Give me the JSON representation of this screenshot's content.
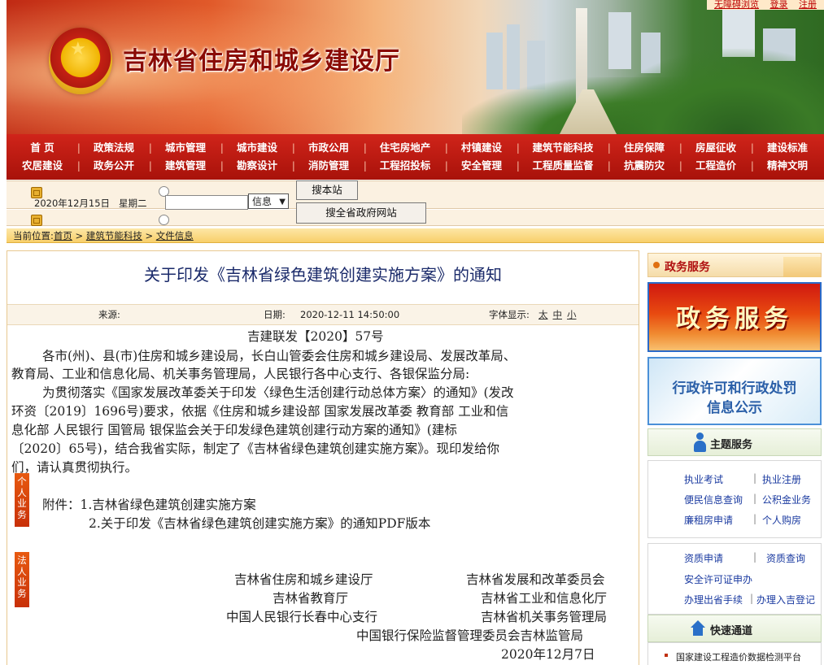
{
  "header": {
    "site_title": "吉林省住房和城乡建设厅",
    "top_links": [
      "无障碍浏览",
      "登录",
      "注册"
    ]
  },
  "nav": {
    "row1": [
      "首  页",
      "政策法规",
      "城市管理",
      "城市建设",
      "市政公用",
      "住宅房地产",
      "村镇建设",
      "建筑节能科技",
      "住房保障",
      "房屋征收",
      "建设标准"
    ],
    "row2": [
      "农居建设",
      "政务公开",
      "建筑管理",
      "勘察设计",
      "消防管理",
      "工程招投标",
      "安全管理",
      "工程质量监督",
      "抗震防灾",
      "工程造价",
      "精神文明"
    ]
  },
  "search": {
    "date": "2020年12月15日",
    "weekday": "星期二",
    "input_value": "",
    "select_value": "信息",
    "btn_site": "搜本站",
    "btn_gov": "搜全省政府网站"
  },
  "breadcrumb": {
    "prefix": "当前位置:",
    "items": [
      "首页",
      "建筑节能科技",
      "文件信息"
    ],
    "sep": ">"
  },
  "article": {
    "title": "关于印发《吉林省绿色建筑创建实施方案》的通知",
    "source_label": "来源:",
    "date_label": "日期:",
    "date_value": "2020-12-11 14:50:00",
    "font_label": "字体显示:",
    "font_sizes": [
      "太",
      "中",
      "小"
    ],
    "doc_no": "吉建联发【2020】57号",
    "lines": [
      "各市(州)、县(市)住房和城乡建设局，长白山管委会住房和城乡建设局、发展改革局、",
      "教育局、工业和信息化局、机关事务管理局，人民银行各中心支行、各银保监分局:",
      "为贯彻落实《国家发展改革委关于印发〈绿色生活创建行动总体方案〉的通知》(发改",
      "环资〔2019〕1696号)要求，依据《住房和城乡建设部 国家发展改革委 教育部 工业和信",
      "息化部 人民银行 国管局 银保监会关于印发绿色建筑创建行动方案的通知》(建标",
      "〔2020〕65号)，结合我省实际，制定了《吉林省绿色建筑创建实施方案》。现印发给你",
      "们，请认真贯彻执行。"
    ],
    "attach1": "附件：1.吉林省绿色建筑创建实施方案",
    "attach2": "2.关于印发《吉林省绿色建筑创建实施方案》的通知PDF版本",
    "sign_left": [
      "吉林省住房和城乡建设厅",
      "吉林省教育厅",
      "中国人民银行长春中心支行"
    ],
    "sign_right": [
      "吉林省发展和改革委员会",
      "吉林省工业和信息化厅",
      "吉林省机关事务管理局"
    ],
    "sign_last": "中国银行保险监督管理委员会吉林监管局",
    "sign_date": "2020年12月7日"
  },
  "sidebar": {
    "gov_header": "政务服务",
    "banner1": "政务服务",
    "banner2_line1": "行政许可和行政处罚",
    "banner2_line2": "信息公示",
    "theme_header": "主题服务",
    "personal_tab": "个人业务",
    "personal": [
      [
        "执业考试",
        "执业注册"
      ],
      [
        "便民信息查询",
        "公积金业务"
      ],
      [
        "廉租房申请",
        "个人购房"
      ]
    ],
    "legal_tab": "法人业务",
    "legal": [
      [
        "资质申请",
        "资质查询"
      ],
      [
        "安全许可证申办",
        ""
      ],
      [
        "办理出省手续",
        "办理入吉登记"
      ]
    ],
    "quick_header": "快速通道",
    "quick_item": "国家建设工程造价数据检测平台"
  }
}
